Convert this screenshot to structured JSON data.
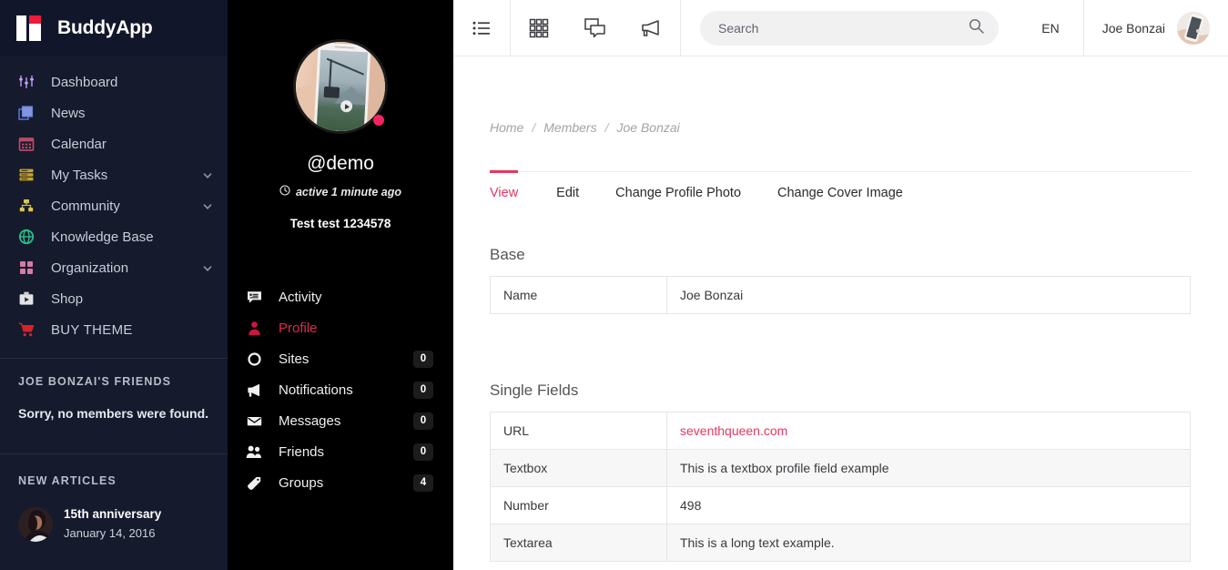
{
  "brand": {
    "name": "BuddyApp",
    "logo_icon": "buddyapp-logo-icon"
  },
  "sidebar": {
    "items": [
      {
        "label": "Dashboard",
        "icon": "sliders-icon",
        "has_chevron": false
      },
      {
        "label": "News",
        "icon": "copy-pages-icon",
        "has_chevron": false
      },
      {
        "label": "Calendar",
        "icon": "calendar-icon",
        "has_chevron": false
      },
      {
        "label": "My Tasks",
        "icon": "server-list-icon",
        "has_chevron": true
      },
      {
        "label": "Community",
        "icon": "sitemap-icon",
        "has_chevron": true
      },
      {
        "label": "Knowledge Base",
        "icon": "globe-icon",
        "has_chevron": false
      },
      {
        "label": "Organization",
        "icon": "grid-squares-icon",
        "has_chevron": true
      },
      {
        "label": "Shop",
        "icon": "briefcase-play-icon",
        "has_chevron": false
      },
      {
        "label": "BUY THEME",
        "icon": "shopping-cart-icon",
        "has_chevron": false
      }
    ],
    "friends_widget": {
      "title": "JOE BONZAI'S FRIENDS",
      "empty_text": "Sorry, no members were found."
    },
    "articles_widget": {
      "title": "NEW ARTICLES",
      "items": [
        {
          "title": "15th anniversary",
          "date": "January 14, 2016",
          "thumb_icon": "article-thumbnail"
        }
      ]
    }
  },
  "topbar": {
    "menu_icon": "list-menu-icon",
    "apps_icon": "grid-apps-icon",
    "messages_icon": "chat-bubbles-icon",
    "announce_icon": "megaphone-icon",
    "search": {
      "value": "",
      "placeholder": "Search",
      "icon": "search-icon"
    },
    "language": "EN",
    "user": {
      "name": "Joe Bonzai",
      "avatar_icon": "user-avatar"
    }
  },
  "profile_panel": {
    "avatar_icon": "profile-avatar-phone-photo",
    "online_status": "online",
    "username": "@demo",
    "active_text": "active 1 minute ago",
    "active_icon": "clock-icon",
    "tagline": "Test test 1234578",
    "nav": [
      {
        "label": "Activity",
        "icon": "activity-comment-icon",
        "count": "",
        "active": false
      },
      {
        "label": "Profile",
        "icon": "user-profile-icon",
        "count": "",
        "active": true
      },
      {
        "label": "Sites",
        "icon": "circle-sites-icon",
        "count": "0",
        "active": false
      },
      {
        "label": "Notifications",
        "icon": "megaphone-icon",
        "count": "0",
        "active": false
      },
      {
        "label": "Messages",
        "icon": "envelope-icon",
        "count": "0",
        "active": false
      },
      {
        "label": "Friends",
        "icon": "users-icon",
        "count": "0",
        "active": false
      },
      {
        "label": "Groups",
        "icon": "tag-icon",
        "count": "4",
        "active": false
      }
    ]
  },
  "main": {
    "breadcrumb": [
      {
        "label": "Home",
        "link": true
      },
      {
        "label": "Members",
        "link": true
      },
      {
        "label": "Joe Bonzai",
        "link": false
      }
    ],
    "breadcrumb_separator": "/",
    "tabs": [
      {
        "label": "View",
        "active": true
      },
      {
        "label": "Edit",
        "active": false
      },
      {
        "label": "Change Profile Photo",
        "active": false
      },
      {
        "label": "Change Cover Image",
        "active": false
      }
    ],
    "sections": [
      {
        "title": "Base",
        "rows": [
          {
            "key": "Name",
            "value": "Joe Bonzai",
            "is_link": false
          }
        ]
      },
      {
        "title": "Single Fields",
        "rows": [
          {
            "key": "URL",
            "value": "seventhqueen.com",
            "is_link": true
          },
          {
            "key": "Textbox",
            "value": "This is a textbox profile field example",
            "is_link": false
          },
          {
            "key": "Number",
            "value": "498",
            "is_link": false
          },
          {
            "key": "Textarea",
            "value": "This is a long text example.",
            "is_link": false
          }
        ]
      }
    ]
  },
  "colors": {
    "accent": "#e8355e",
    "sidebar_bg": "#151a2d",
    "panel_bg": "#000000",
    "logo_red": "#ec1c3c"
  }
}
